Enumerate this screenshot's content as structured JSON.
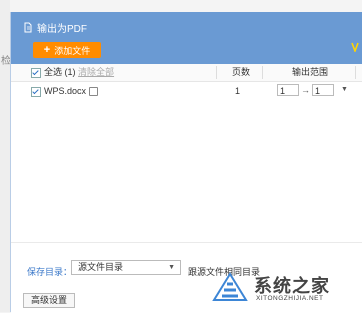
{
  "side": {
    "char": "检"
  },
  "window": {
    "title": "输出为PDF",
    "add_button_label": "添加文件"
  },
  "table": {
    "select_all_label": "全选",
    "selected_count": "(1)",
    "clear_all_label": "清除全部",
    "col_pages": "页数",
    "col_range": "输出范围",
    "rows": [
      {
        "filename": "WPS.docx",
        "pages": "1",
        "range_from": "1",
        "range_to": "1",
        "range_arrow": "→"
      }
    ]
  },
  "footer": {
    "save_label": "保存目录：",
    "save_option": "源文件目录",
    "same_dir_label": "跟源文件相同目录",
    "advanced_label": "高级设置"
  },
  "watermark": {
    "text": "系统之家",
    "sub": "XITONGZHIJIA.NET"
  }
}
